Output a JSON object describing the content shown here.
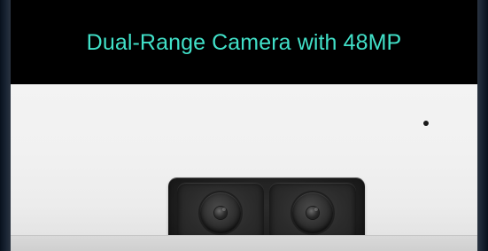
{
  "headline": "Dual-Range Camera with 48MP",
  "colors": {
    "headline_text": "#41e0c8",
    "top_band": "#000000",
    "device_body": "#f1f1f1",
    "camera_module": "#1f1f1f"
  },
  "icons": {
    "camera_lens_left": "camera-lens-icon",
    "camera_lens_right": "camera-lens-icon",
    "sensor": "sensor-dot-icon"
  }
}
